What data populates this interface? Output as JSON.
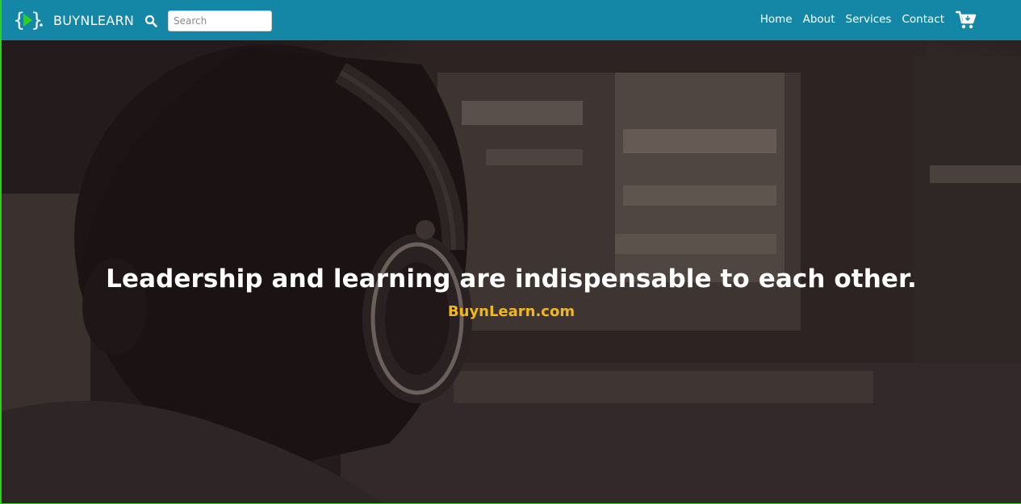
{
  "navbar": {
    "brand_name": "BUYNLEARN",
    "brand_logo_icon": "code-braces-play-icon",
    "search_icon": "search-icon",
    "search": {
      "placeholder": "Search",
      "value": ""
    },
    "links": [
      {
        "label": "Home"
      },
      {
        "label": "About"
      },
      {
        "label": "Services"
      },
      {
        "label": "Contact"
      }
    ],
    "cart_icon": "cart-icon"
  },
  "hero": {
    "quote": "Leadership and learning are indispensable to each other.",
    "site": "BuynLearn.com",
    "background_image": "person-with-headphones-at-computer"
  },
  "colors": {
    "navbar_bg": "#1587a6",
    "accent_green": "#2bd11a",
    "site_text": "#f2b71c",
    "overlay": "#1a1214"
  }
}
